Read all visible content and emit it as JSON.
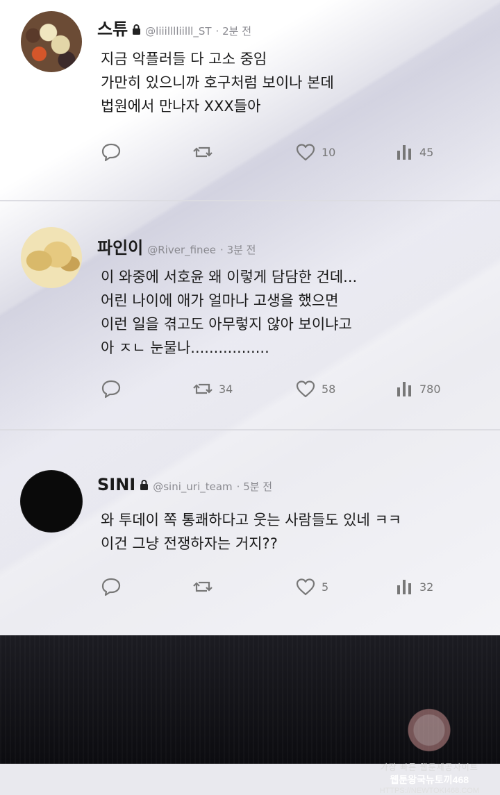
{
  "tweets": [
    {
      "name": "스튜",
      "locked": true,
      "handle": "@liiilllliilll_ST",
      "time": "· 2분 전",
      "lines": [
        "지금 악플러들 다 고소 중임",
        "가만히 있으니까 호구처럼 보이나 본데",
        "법원에서 만나자 XXX들아"
      ],
      "retweets": "",
      "likes": "10",
      "views": "45"
    },
    {
      "name": "파인이",
      "locked": false,
      "handle": "@River_finee",
      "time": "· 3분 전",
      "lines": [
        "이 와중에 서호윤 왜 이렇게 담담한 건데...",
        "어린 나이에 애가 얼마나 고생을 했으면",
        "이런 일을 겪고도 아무렇지 않아 보이냐고",
        "아 ㅈㄴ 눈물나................."
      ],
      "retweets": "34",
      "likes": "58",
      "views": "780"
    },
    {
      "name": "SINI",
      "locked": true,
      "handle": "@sini_uri_team",
      "time": "· 5분 전",
      "lines": [
        "와 투데이 쪽 통쾌하다고 웃는 사람들도 있네 ㅋㅋ",
        "이건 그냥 전쟁하자는 거지??"
      ],
      "retweets": "",
      "likes": "5",
      "views": "32"
    }
  ],
  "icons": {
    "reply": "reply-icon",
    "retweet": "retweet-icon",
    "like": "heart-icon",
    "views": "views-icon",
    "lock": "lock-icon"
  },
  "watermark": {
    "line1": "가장 빠른 웹툰제공사이트",
    "line2": "웹툰왕국뉴토끼468",
    "line3": "HTTPS://NEWTOKI468.COM"
  },
  "colors": {
    "text": "#1a1a1a",
    "meta": "#8a8a90",
    "icon": "#777777"
  }
}
